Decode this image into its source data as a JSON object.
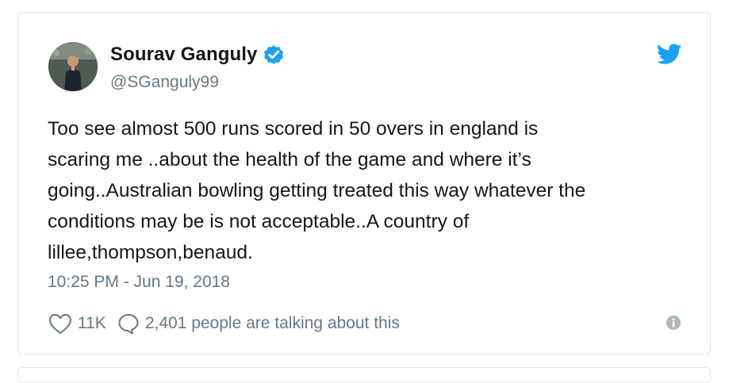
{
  "tweet": {
    "author": {
      "display_name": "Sourav Ganguly",
      "handle": "@SGanguly99",
      "verified": true
    },
    "text_lines": [
      "Too see almost 500 runs scored in 50 overs in england is",
      "scaring me ..about the health of the game and where it’s",
      "going..Australian bowling getting treated this way whatever the",
      "conditions may be is not acceptable..A country of",
      "lillee,thompson,benaud."
    ],
    "timestamp": "10:25 PM - Jun 19, 2018",
    "likes": "11K",
    "talking": "2,401 people are talking about this"
  },
  "icons": {
    "brand": "twitter-bird-icon",
    "verified": "verified-badge-icon",
    "like": "heart-icon",
    "reply": "reply-bubble-icon",
    "info": "info-icon"
  },
  "colors": {
    "brand_blue": "#1da1f2",
    "text": "#14171a",
    "secondary_text": "#657786",
    "border": "#e1e8ed",
    "info_icon": "#aab8c2"
  }
}
